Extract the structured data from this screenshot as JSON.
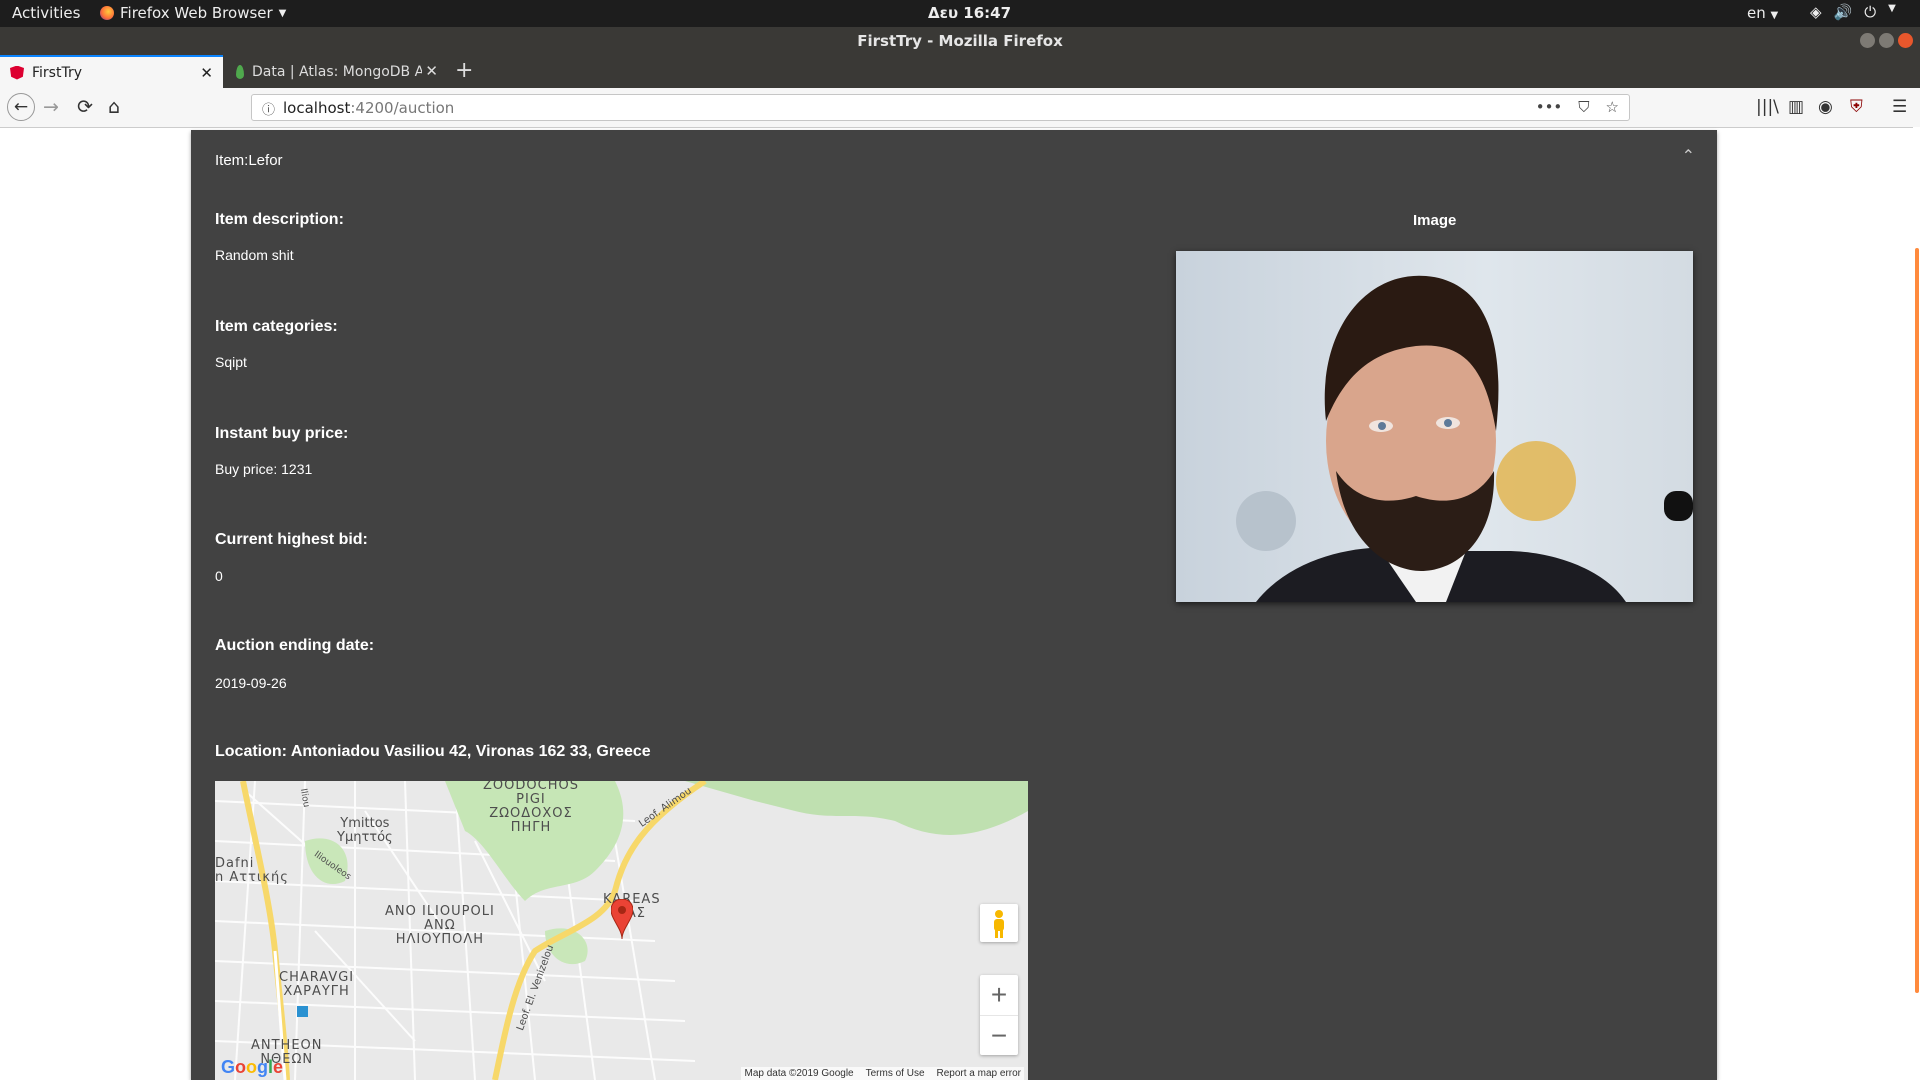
{
  "system": {
    "activities": "Activities",
    "app_menu": "Firefox Web Browser",
    "clock": "Δευ 16:47",
    "lang": "en"
  },
  "window": {
    "title": "FirstTry - Mozilla Firefox"
  },
  "tabs": [
    {
      "label": "FirstTry",
      "active": true
    },
    {
      "label": "Data | Atlas: MongoDB A",
      "active": false
    }
  ],
  "url": {
    "host": "localhost",
    "rest": ":4200/auction"
  },
  "page": {
    "header": "Item:Lefor",
    "image_label": "Image",
    "fields": [
      {
        "label": "Item description:",
        "value": "Random shit"
      },
      {
        "label": "Item categories:",
        "value": "Sqipt"
      },
      {
        "label": "Instant buy price:",
        "value": "Buy price: 1231"
      },
      {
        "label": "Current highest bid:",
        "value": "0"
      },
      {
        "label": "Auction ending date:",
        "value": "2019-09-26"
      }
    ],
    "location": "Location: Antoniadou Vasiliou 42, Vironas 162 33, Greece"
  },
  "map": {
    "labels": [
      {
        "text": "ZOODOCHOS\nPIGI\nΖΩΟΔΟΧΟΣ\nΠΗΓΗ"
      },
      {
        "text": "Ymittos\nΥμηττός"
      },
      {
        "text": "Dafni\nn Αττικής"
      },
      {
        "text": "ANO ILIOUPOLI\nΑΝΩ\nΗΛΙΟΥΠΟΛΗ"
      },
      {
        "text": "KAREAS\nΕΑΣ"
      },
      {
        "text": "CHARAVGI\nΧΑΡΑΥΓΗ"
      },
      {
        "text": "ANTHEON\nΝΘΕΩΝ"
      },
      {
        "text": "Leof. Alimou"
      },
      {
        "text": "Leof. El. Venizelou"
      },
      {
        "text": "Iliou"
      },
      {
        "text": "Iliouoleos"
      }
    ],
    "logo": "Google",
    "attribution": [
      "Map data ©2019 Google",
      "Terms of Use",
      "Report a map error"
    ]
  }
}
